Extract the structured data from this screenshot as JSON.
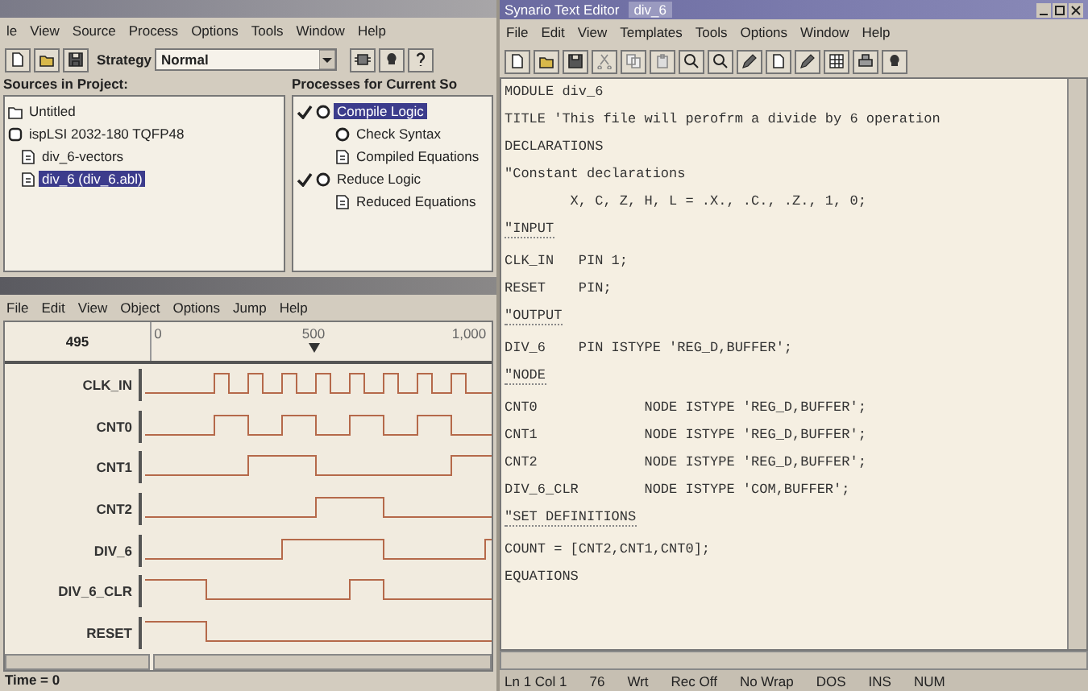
{
  "project_window": {
    "menu": [
      "le",
      "View",
      "Source",
      "Process",
      "Options",
      "Tools",
      "Window",
      "Help"
    ],
    "toolbar": {
      "strategy_label": "Strategy",
      "strategy_value": "Normal"
    },
    "sources": {
      "header": "Sources in Project:",
      "items": [
        {
          "label": "Untitled",
          "kind": "project",
          "selected": false
        },
        {
          "label": "ispLSI 2032-180 TQFP48",
          "kind": "device",
          "selected": false,
          "children": [
            {
              "label": "div_6-vectors",
              "selected": false
            },
            {
              "label": "div_6 (div_6.abl)",
              "selected": true
            }
          ]
        }
      ]
    },
    "processes": {
      "header": "Processes for Current So",
      "items": [
        {
          "label": "Compile Logic",
          "kind": "process",
          "checked": true,
          "selected": true,
          "children": [
            {
              "label": "Check Syntax",
              "kind": "process",
              "checked": false,
              "selected": false
            },
            {
              "label": "Compiled Equations",
              "kind": "report",
              "checked": false,
              "selected": false
            }
          ]
        },
        {
          "label": "Reduce Logic",
          "kind": "process",
          "checked": true,
          "selected": false,
          "children": [
            {
              "label": "Reduced Equations",
              "kind": "report",
              "checked": false,
              "selected": false
            }
          ]
        }
      ]
    }
  },
  "waveform_window": {
    "menu": [
      "File",
      "Edit",
      "View",
      "Object",
      "Options",
      "Jump",
      "Help"
    ],
    "cursor_time": "495",
    "ruler": [
      "0",
      "500",
      "1,000"
    ],
    "signals": [
      "CLK_IN",
      "CNT0",
      "CNT1",
      "CNT2",
      "DIV_6",
      "DIV_6_CLR",
      "RESET"
    ],
    "status": "Time = 0"
  },
  "editor": {
    "title": "Synario Text Editor",
    "document": "div_6",
    "menu": [
      "File",
      "Edit",
      "View",
      "Templates",
      "Tools",
      "Options",
      "Window",
      "Help"
    ],
    "lines": [
      {
        "kind": "keyword",
        "text": "MODULE div_6"
      },
      {
        "kind": "keyword",
        "text": "TITLE 'This file will perofrm a divide by 6 operation"
      },
      {
        "kind": "keyword",
        "text": "DECLARATIONS"
      },
      {
        "kind": "comment",
        "text": "\"Constant declarations"
      },
      {
        "kind": "code",
        "text": "        X, C, Z, H, L = .X., .C., .Z., 1, 0;"
      },
      {
        "kind": "heading",
        "text": "\"INPUT"
      },
      {
        "kind": "code",
        "text": "CLK_IN   PIN 1;"
      },
      {
        "kind": "code",
        "text": "RESET    PIN;"
      },
      {
        "kind": "heading",
        "text": "\"OUTPUT"
      },
      {
        "kind": "code",
        "text": "DIV_6    PIN ISTYPE 'REG_D,BUFFER';"
      },
      {
        "kind": "heading",
        "text": "\"NODE"
      },
      {
        "kind": "code",
        "text": "CNT0             NODE ISTYPE 'REG_D,BUFFER';"
      },
      {
        "kind": "code",
        "text": "CNT1             NODE ISTYPE 'REG_D,BUFFER';"
      },
      {
        "kind": "code",
        "text": "CNT2             NODE ISTYPE 'REG_D,BUFFER';"
      },
      {
        "kind": "code",
        "text": "DIV_6_CLR        NODE ISTYPE 'COM,BUFFER';"
      },
      {
        "kind": "heading",
        "text": "\"SET DEFINITIONS"
      },
      {
        "kind": "code",
        "text": "COUNT = [CNT2,CNT1,CNT0];"
      },
      {
        "kind": "keyword",
        "text": "EQUATIONS"
      }
    ],
    "status": [
      "Ln 1 Col 1",
      "76",
      "Wrt",
      "Rec Off",
      "No Wrap",
      "DOS",
      "INS",
      "NUM"
    ]
  }
}
